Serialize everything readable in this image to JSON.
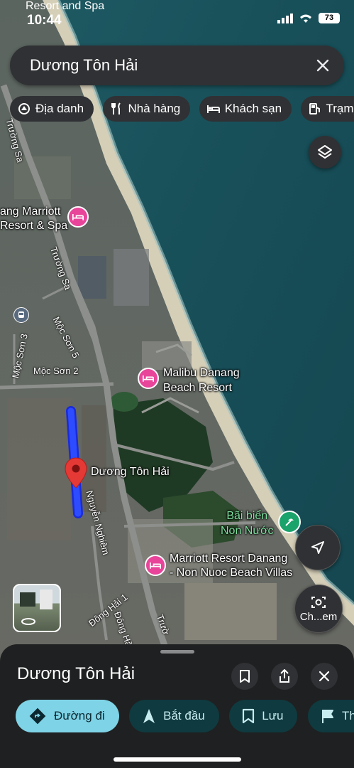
{
  "status": {
    "time": "10:44",
    "battery": "73",
    "top_label": "Resort and Spa"
  },
  "search": {
    "query": "Dương Tôn Hải"
  },
  "chips": [
    {
      "label": "Địa danh",
      "icon": "landmark-icon"
    },
    {
      "label": "Nhà hàng",
      "icon": "restaurant-icon"
    },
    {
      "label": "Khách sạn",
      "icon": "hotel-icon"
    },
    {
      "label": "Trạm x",
      "icon": "gas-station-icon"
    }
  ],
  "map": {
    "places": {
      "marriott_spa": "ang Marriott\nResort & Spa",
      "malibu": "Malibu Danang\nBeach Resort",
      "duong_ton_hai": "Dương Tôn Hải",
      "bai_bien": "Bãi biển\nNon Nước",
      "marriott_villas": "Marriott Resort Danang\n- Non Nuoc Beach Villas"
    },
    "roads": {
      "truong_sa_top": "Trường Sa",
      "truong_sa_mid": "Trường Sa",
      "moc_son_5": "Mộc Sơn 5",
      "moc_son_3": "Mộc Sơn 3",
      "moc_son_2": "Mộc Sơn 2",
      "nguyen_nghiem": "Nguyễn Nghiêm",
      "dong_hai_1": "Đông Hải 1",
      "dong_hai": "Đông Hải",
      "truong_bottom": "Trườ"
    },
    "lens_label": "Ch...em"
  },
  "sheet": {
    "title": "Dương Tôn Hải",
    "actions": [
      {
        "label": "Đường đi",
        "icon": "directions-icon"
      },
      {
        "label": "Bắt đầu",
        "icon": "navigation-arrow-icon"
      },
      {
        "label": "Lưu",
        "icon": "bookmark-icon"
      },
      {
        "label": "Thêm",
        "icon": "flag-icon"
      }
    ]
  }
}
